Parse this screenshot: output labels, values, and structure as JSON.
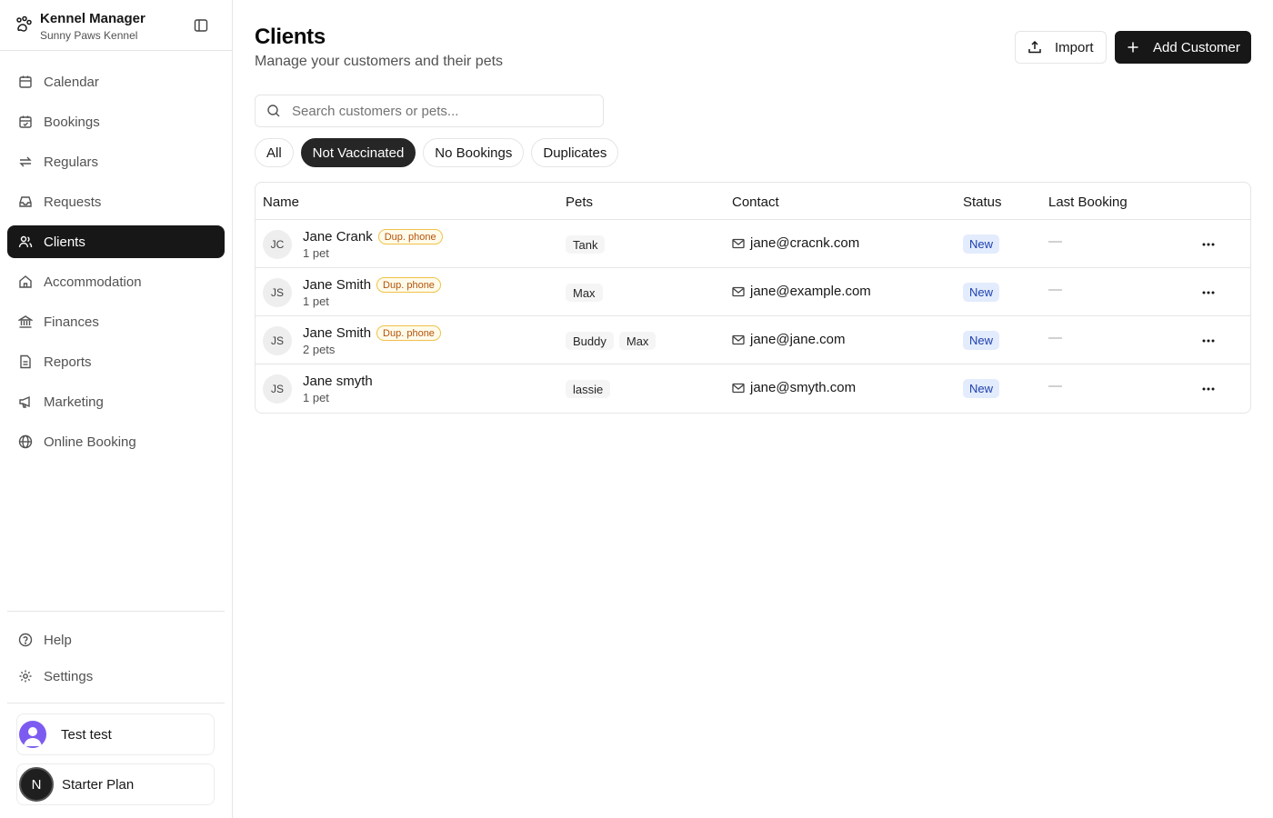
{
  "app": {
    "name": "Kennel Manager",
    "subtitle": "Sunny Paws Kennel"
  },
  "sidebar": {
    "items": [
      {
        "label": "Calendar",
        "icon": "calendar-icon",
        "active": false
      },
      {
        "label": "Bookings",
        "icon": "calendar-check-icon",
        "active": false
      },
      {
        "label": "Regulars",
        "icon": "repeat-icon",
        "active": false
      },
      {
        "label": "Requests",
        "icon": "inbox-icon",
        "active": false
      },
      {
        "label": "Clients",
        "icon": "users-icon",
        "active": true
      },
      {
        "label": "Accommodation",
        "icon": "home-icon",
        "active": false
      },
      {
        "label": "Finances",
        "icon": "bank-icon",
        "active": false
      },
      {
        "label": "Reports",
        "icon": "file-text-icon",
        "active": false
      },
      {
        "label": "Marketing",
        "icon": "megaphone-icon",
        "active": false
      },
      {
        "label": "Online Booking",
        "icon": "globe-icon",
        "active": false
      }
    ],
    "bottom": [
      {
        "label": "Help",
        "icon": "help-circle-icon"
      },
      {
        "label": "Settings",
        "icon": "gear-icon"
      }
    ],
    "user": {
      "name": "Test test"
    },
    "plan": {
      "label": "Starter Plan",
      "initial": "N"
    }
  },
  "header": {
    "title": "Clients",
    "subtitle": "Manage your customers and their pets",
    "import_label": "Import",
    "add_label": "Add Customer"
  },
  "search": {
    "placeholder": "Search customers or pets...",
    "value": ""
  },
  "filters": [
    {
      "label": "All",
      "active": false
    },
    {
      "label": "Not Vaccinated",
      "active": true
    },
    {
      "label": "No Bookings",
      "active": false
    },
    {
      "label": "Duplicates",
      "active": false
    }
  ],
  "table": {
    "columns": [
      "Name",
      "Pets",
      "Contact",
      "Status",
      "Last Booking"
    ],
    "rows": [
      {
        "initials": "JC",
        "name": "Jane Crank",
        "badge": "Dup. phone",
        "pet_count": "1 pet",
        "pets": [
          "Tank"
        ],
        "email": "jane@cracnk.com",
        "status": "New",
        "last_booking": "—"
      },
      {
        "initials": "JS",
        "name": "Jane Smith",
        "badge": "Dup. phone",
        "pet_count": "1 pet",
        "pets": [
          "Max"
        ],
        "email": "jane@example.com",
        "status": "New",
        "last_booking": "—"
      },
      {
        "initials": "JS",
        "name": "Jane Smith",
        "badge": "Dup. phone",
        "pet_count": "2 pets",
        "pets": [
          "Buddy",
          "Max"
        ],
        "email": "jane@jane.com",
        "status": "New",
        "last_booking": "—"
      },
      {
        "initials": "JS",
        "name": "Jane smyth",
        "badge": "",
        "pet_count": "1 pet",
        "pets": [
          "lassie"
        ],
        "email": "jane@smyth.com",
        "status": "New",
        "last_booking": "—"
      }
    ]
  },
  "colors": {
    "primary": "#171717",
    "border": "#e5e5e5",
    "badge_warn": "#b45309",
    "status_bg": "#e3ecfd",
    "status_text": "#1e40af"
  }
}
